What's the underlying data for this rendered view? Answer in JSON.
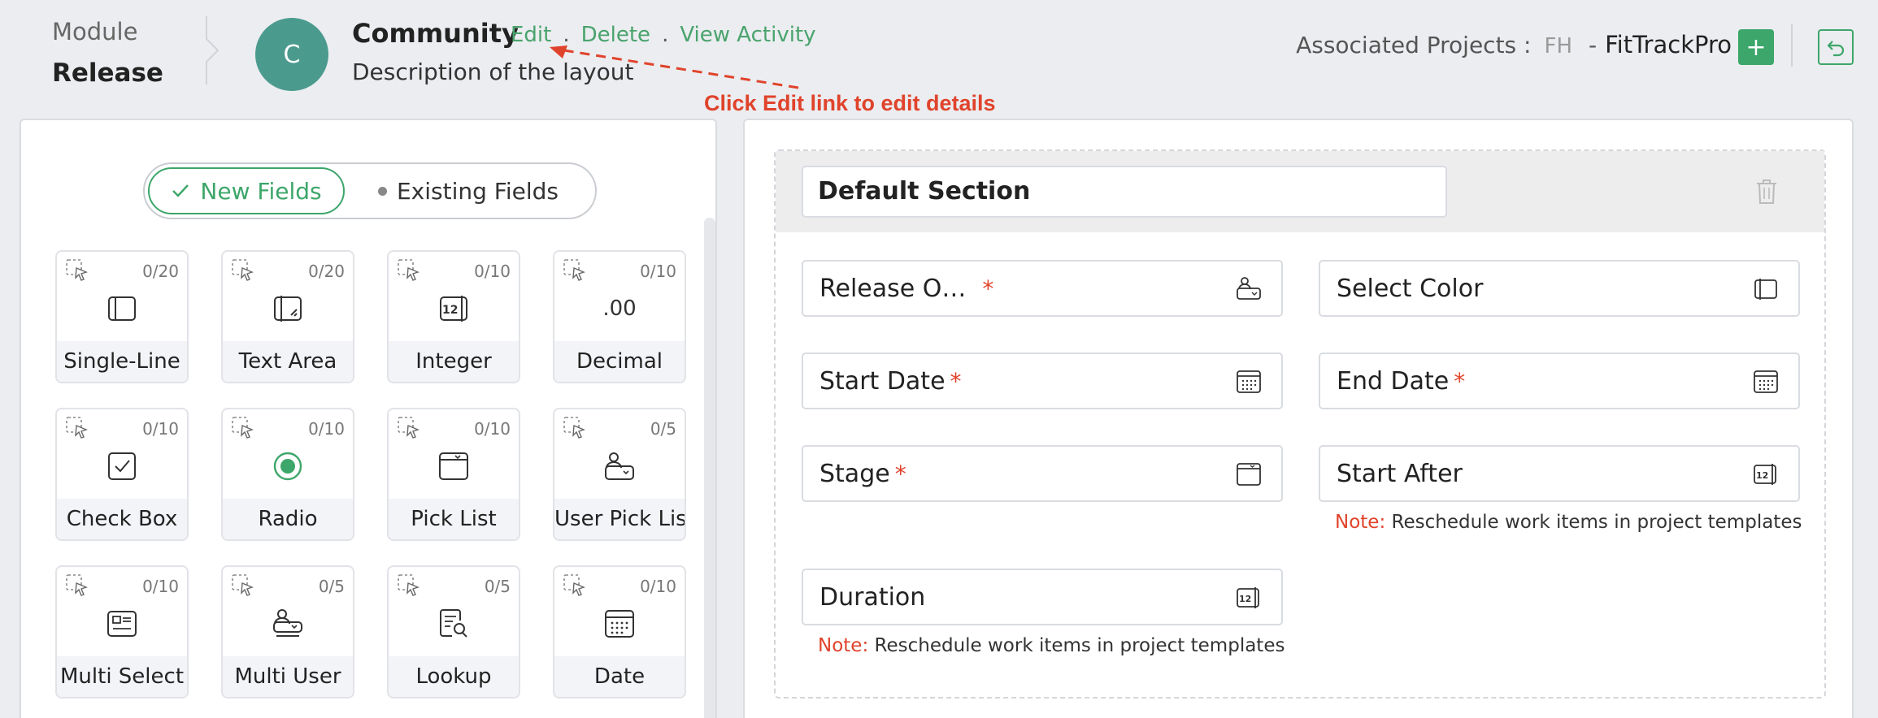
{
  "header": {
    "module_label": "Module",
    "module_value": "Release",
    "avatar_letter": "C",
    "layout_title": "Community",
    "links": {
      "edit": "Edit",
      "delete": "Delete",
      "view_activity": "View Activity",
      "sep": "."
    },
    "description": "Description of the layout",
    "callout": "Click Edit link to edit details",
    "associated_label": "Associated Projects :",
    "project_abbr": "FH",
    "project_dash": "-",
    "project_name": "FitTrackPro",
    "add_label": "+"
  },
  "palette": {
    "toggle_new": "New Fields",
    "toggle_existing": "Existing Fields",
    "cards": [
      {
        "name": "Single-Line",
        "count": "0/20",
        "icon": "single-line-icon"
      },
      {
        "name": "Text Area",
        "count": "0/20",
        "icon": "text-area-icon"
      },
      {
        "name": "Integer",
        "count": "0/10",
        "icon": "integer-icon"
      },
      {
        "name": "Decimal",
        "count": "0/10",
        "icon": "decimal-icon",
        "glyph": ".00"
      },
      {
        "name": "Check Box",
        "count": "0/10",
        "icon": "checkbox-icon"
      },
      {
        "name": "Radio",
        "count": "0/10",
        "icon": "radio-icon"
      },
      {
        "name": "Pick List",
        "count": "0/10",
        "icon": "pick-list-icon"
      },
      {
        "name": "User Pick List",
        "count": "0/5",
        "icon": "user-pick-list-icon"
      },
      {
        "name": "Multi Select",
        "count": "0/10",
        "icon": "multi-select-icon"
      },
      {
        "name": "Multi User",
        "count": "0/5",
        "icon": "multi-user-icon"
      },
      {
        "name": "Lookup",
        "count": "0/5",
        "icon": "lookup-icon"
      },
      {
        "name": "Date",
        "count": "0/10",
        "icon": "date-icon"
      }
    ]
  },
  "section": {
    "name": "Default Section",
    "fields": [
      {
        "label": "Release O…",
        "required": true,
        "icon": "user-pick-icon"
      },
      {
        "label": "Select Color",
        "required": false,
        "icon": "single-line-icon"
      },
      {
        "label": "Start Date",
        "required": true,
        "icon": "calendar-icon"
      },
      {
        "label": "End Date",
        "required": true,
        "icon": "calendar-icon"
      },
      {
        "label": "Stage",
        "required": true,
        "icon": "pick-list-icon"
      },
      {
        "label": "Start After",
        "required": false,
        "icon": "integer-icon"
      },
      {
        "label": "Duration",
        "required": false,
        "icon": "integer-icon"
      }
    ],
    "required_mark": "*",
    "note_label": "Note:",
    "note_text": "Reschedule work items in project templates"
  },
  "colors": {
    "accent": "#3da66a",
    "avatar": "#4b9a8e",
    "callout": "#e0432b"
  }
}
